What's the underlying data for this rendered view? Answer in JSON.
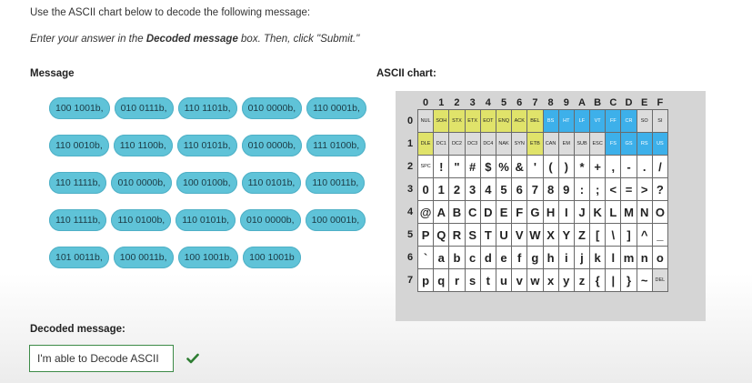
{
  "instructions": {
    "line1": "Use the ASCII chart below to decode the following message:",
    "line2_pre": "Enter your answer in the ",
    "line2_bold": "Decoded message",
    "line2_post": " box. Then, click \"Submit.\""
  },
  "message": {
    "heading": "Message",
    "rows": [
      [
        "100 1001b,",
        "010 0111b,",
        "110 1101b,",
        "010 0000b,",
        "110 0001b,"
      ],
      [
        "110 0010b,",
        "110 1100b,",
        "110 0101b,",
        "010 0000b,",
        "111 0100b,"
      ],
      [
        "110 1111b,",
        "010 0000b,",
        "100 0100b,",
        "110 0101b,",
        "110 0011b,"
      ],
      [
        "110 1111b,",
        "110 0100b,",
        "110 0101b,",
        "010 0000b,",
        "100 0001b,"
      ],
      [
        "101 0011b,",
        "100 0011b,",
        "100 1001b,",
        "100 1001b"
      ]
    ]
  },
  "ascii_chart": {
    "heading": "ASCII chart:",
    "columns": [
      "0",
      "1",
      "2",
      "3",
      "4",
      "5",
      "6",
      "7",
      "8",
      "9",
      "A",
      "B",
      "C",
      "D",
      "E",
      "F"
    ],
    "rows": [
      {
        "label": "0",
        "cells": [
          "NUL",
          "SOH",
          "STX",
          "ETX",
          "EOT",
          "ENQ",
          "ACK",
          "BEL",
          "BS",
          "HT",
          "LF",
          "VT",
          "FF",
          "CR",
          "SO",
          "SI"
        ],
        "colors": [
          "g",
          "y",
          "y",
          "y",
          "y",
          "y",
          "y",
          "y",
          "b",
          "b",
          "b",
          "b",
          "b",
          "b",
          "g",
          "g"
        ]
      },
      {
        "label": "1",
        "cells": [
          "DLE",
          "DC1",
          "DC2",
          "DC3",
          "DC4",
          "NAK",
          "SYN",
          "ETB",
          "CAN",
          "EM",
          "SUB",
          "ESC",
          "FS",
          "GS",
          "RS",
          "US"
        ],
        "colors": [
          "y",
          "g",
          "g",
          "g",
          "g",
          "g",
          "g",
          "y",
          "g",
          "g",
          "g",
          "g",
          "b",
          "b",
          "b",
          "b"
        ]
      },
      {
        "label": "2",
        "cells": [
          "SPC",
          "!",
          "\"",
          "#",
          "$",
          "%",
          "&",
          "'",
          "(",
          ")",
          "*",
          "+",
          ",",
          "-",
          ".",
          "/"
        ]
      },
      {
        "label": "3",
        "cells": [
          "0",
          "1",
          "2",
          "3",
          "4",
          "5",
          "6",
          "7",
          "8",
          "9",
          ":",
          ";",
          "<",
          "=",
          ">",
          "?"
        ]
      },
      {
        "label": "4",
        "cells": [
          "@",
          "A",
          "B",
          "C",
          "D",
          "E",
          "F",
          "G",
          "H",
          "I",
          "J",
          "K",
          "L",
          "M",
          "N",
          "O"
        ]
      },
      {
        "label": "5",
        "cells": [
          "P",
          "Q",
          "R",
          "S",
          "T",
          "U",
          "V",
          "W",
          "X",
          "Y",
          "Z",
          "[",
          "\\",
          "]",
          "^",
          "_"
        ]
      },
      {
        "label": "6",
        "cells": [
          "`",
          "a",
          "b",
          "c",
          "d",
          "e",
          "f",
          "g",
          "h",
          "i",
          "j",
          "k",
          "l",
          "m",
          "n",
          "o"
        ]
      },
      {
        "label": "7",
        "cells": [
          "p",
          "q",
          "r",
          "s",
          "t",
          "u",
          "v",
          "w",
          "x",
          "y",
          "z",
          "{",
          "|",
          "}",
          "~",
          "DEL"
        ],
        "colors": [
          "",
          "",
          "",
          "",
          "",
          "",
          "",
          "",
          "",
          "",
          "",
          "",
          "",
          "",
          "",
          "g"
        ]
      }
    ]
  },
  "decoded": {
    "heading": "Decoded message:",
    "value": "I'm able to Decode ASCII",
    "status_icon": "check-icon",
    "accent_color": "#3c8a47"
  }
}
